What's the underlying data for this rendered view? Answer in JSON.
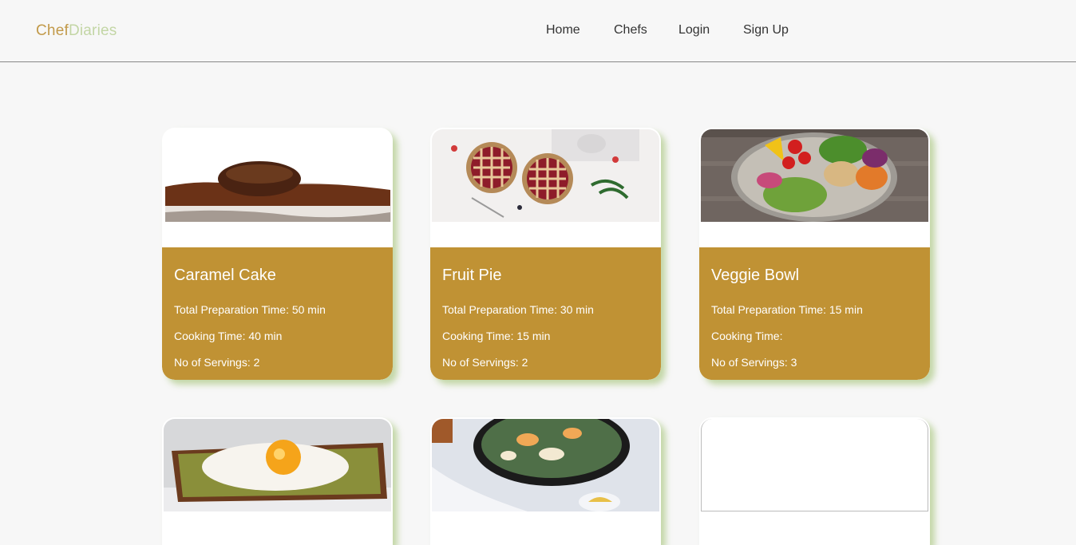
{
  "brand": {
    "part1": "Chef",
    "part2": "Diaries"
  },
  "nav": {
    "home": "Home",
    "chefs": "Chefs",
    "login": "Login",
    "signup": "Sign Up"
  },
  "recipes": [
    {
      "title": "Caramel Cake",
      "prep": "Total Preparation Time: 50 min",
      "cook": "Cooking Time: 40 min",
      "servings": "No of Servings: 2"
    },
    {
      "title": "Fruit Pie",
      "prep": "Total Preparation Time: 30 min",
      "cook": "Cooking Time: 15 min",
      "servings": "No of Servings: 2"
    },
    {
      "title": "Veggie Bowl",
      "prep": "Total Preparation Time: 15 min",
      "cook": "Cooking Time:",
      "servings": "No of Servings: 3"
    }
  ],
  "colors": {
    "card_info_bg": "#c09234",
    "brand_part1": "#c29a4a",
    "brand_part2": "#c3d6a5",
    "card_shadow": "#b2cc8c"
  }
}
